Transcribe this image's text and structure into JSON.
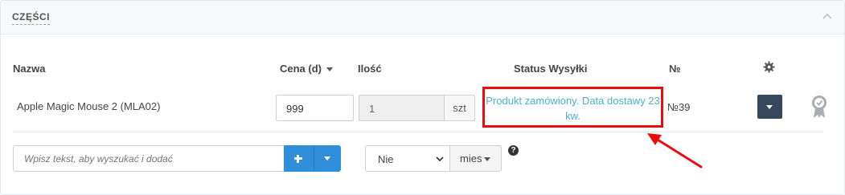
{
  "panel": {
    "title": "CZĘŚCI",
    "collapse_icon": "chevron-up-icon"
  },
  "table": {
    "headers": {
      "name": "Nazwa",
      "price": "Cena (d)",
      "quantity": "Ilość",
      "status": "Status Wysyłki",
      "number": "№",
      "settings_icon": "gear-icon"
    },
    "rows": [
      {
        "name": "Apple Magic Mouse 2 (MLA02)",
        "price": "999",
        "quantity": "1",
        "unit": "szt",
        "status": "Produkt zamówiony. Data dostawy 23 kw.",
        "number": "№39",
        "actions_icon": "caret-down-icon",
        "badge_icon": "award-icon"
      }
    ]
  },
  "add_part": {
    "search_placeholder": "Wpisz tekst, aby wyszukać i dodać",
    "add_icon": "plus-icon",
    "more_icon": "caret-down-icon",
    "warranty_value": "Nie",
    "warranty_unit": "mies",
    "help_icon": "question-icon",
    "help_glyph": "?"
  },
  "colors": {
    "status_link": "#4bb3c8",
    "highlight": "#ea0d0d",
    "primary": "#2f8fdb",
    "dark_button": "#34495e"
  }
}
